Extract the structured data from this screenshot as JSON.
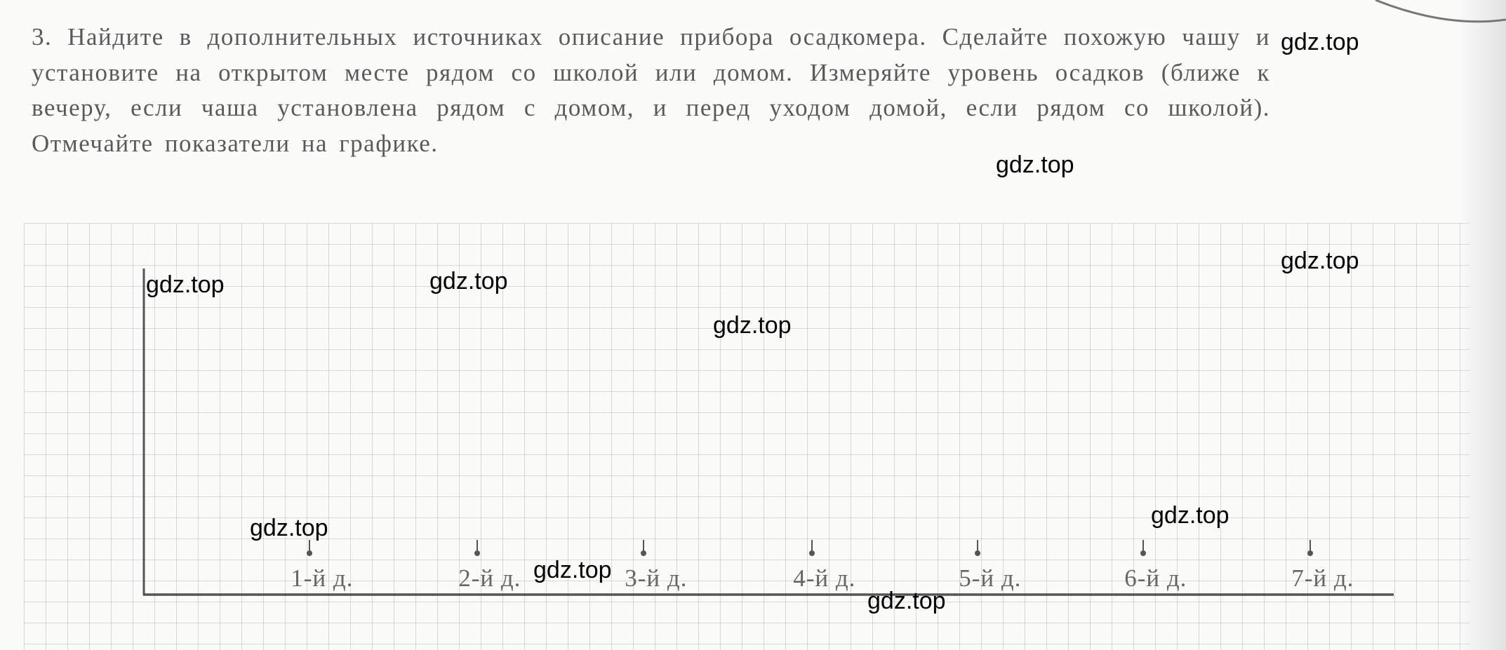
{
  "task": {
    "text": "3. Найдите в дополнительных источниках описание прибора осадкомера. Сделайте похожую чашу и установите на открытом месте рядом со школой или домом. Измеряйте уровень осадков (ближе к вечеру, если чаша установлена рядом с домом, и перед уходом домой, если рядом со школой). Отмечайте показатели на графике."
  },
  "chart": {
    "x_labels": [
      "1-й д.",
      "2-й д.",
      "3-й д.",
      "4-й д.",
      "5-й д.",
      "6-й д.",
      "7-й д."
    ]
  },
  "watermark": "gdz.top"
}
